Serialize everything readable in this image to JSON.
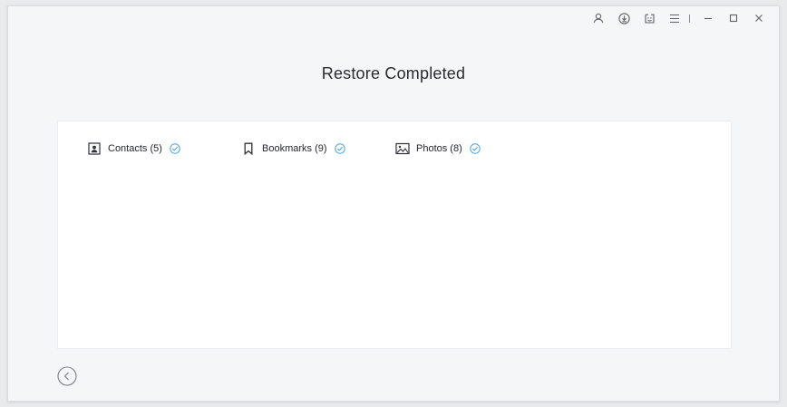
{
  "page": {
    "title": "Restore Completed"
  },
  "titlebar": {
    "buttons": [
      {
        "icon": "user-icon"
      },
      {
        "icon": "download-icon"
      },
      {
        "icon": "feedback-icon"
      },
      {
        "icon": "menu-icon"
      },
      {
        "icon": "minimize-icon"
      },
      {
        "icon": "maximize-icon"
      },
      {
        "icon": "close-icon"
      }
    ]
  },
  "results": {
    "items": [
      {
        "label": "Contacts (5)",
        "icon": "contacts-icon",
        "status": "completed"
      },
      {
        "label": "Bookmarks (9)",
        "icon": "bookmark-icon",
        "status": "completed"
      },
      {
        "label": "Photos (8)",
        "icon": "photo-icon",
        "status": "completed"
      }
    ]
  },
  "colors": {
    "accent_check": "#4aa3df",
    "icon_gray": "#6b6e74",
    "text": "#25272b",
    "background": "#f5f6f8",
    "panel": "#ffffff"
  },
  "navigation": {
    "back_icon": "chevron-left-icon"
  }
}
